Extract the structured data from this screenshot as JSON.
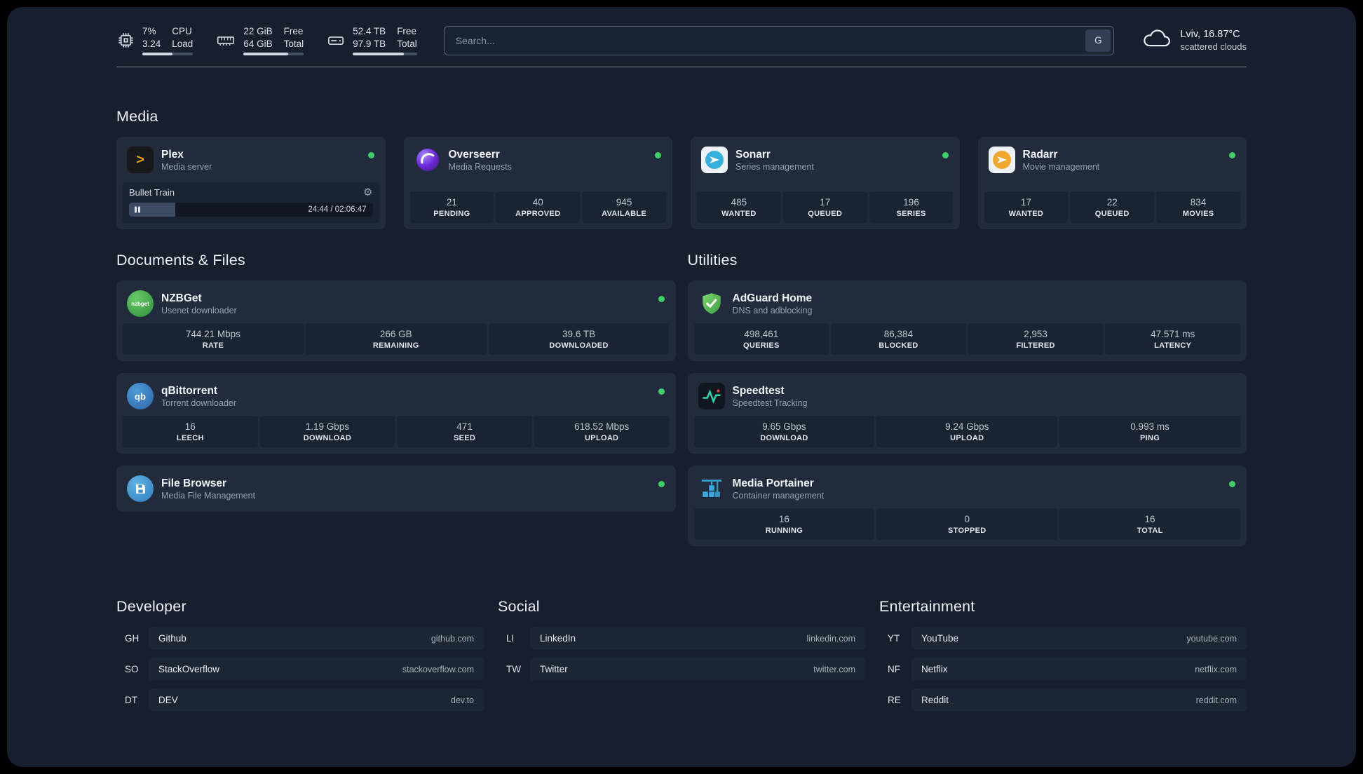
{
  "topbar": {
    "resources": [
      {
        "col1_top": "7%",
        "col1_bottom": "3.24",
        "col2_top": "CPU",
        "col2_bottom": "Load",
        "bar_percent": 60
      },
      {
        "col1_top": "22 GiB",
        "col1_bottom": "64 GiB",
        "col2_top": "Free",
        "col2_bottom": "Total",
        "bar_percent": 74
      },
      {
        "col1_top": "52.4 TB",
        "col1_bottom": "97.9 TB",
        "col2_top": "Free",
        "col2_bottom": "Total",
        "bar_percent": 80
      }
    ],
    "search": {
      "placeholder": "Search...",
      "provider_label": "G"
    },
    "weather": {
      "location": "Lviv, 16.87°C",
      "condition": "scattered clouds"
    }
  },
  "media": {
    "title": "Media",
    "cards": [
      {
        "name": "Plex",
        "description": "Media server",
        "icon_text": ">",
        "now_playing": {
          "title": "Bullet Train",
          "time": "24:44 / 02:06:47",
          "progress_percent": 19
        }
      },
      {
        "name": "Overseerr",
        "description": "Media Requests",
        "stats": [
          {
            "value": "21",
            "label": "PENDING"
          },
          {
            "value": "40",
            "label": "APPROVED"
          },
          {
            "value": "945",
            "label": "AVAILABLE"
          }
        ]
      },
      {
        "name": "Sonarr",
        "description": "Series management",
        "stats": [
          {
            "value": "485",
            "label": "WANTED"
          },
          {
            "value": "17",
            "label": "QUEUED"
          },
          {
            "value": "196",
            "label": "SERIES"
          }
        ]
      },
      {
        "name": "Radarr",
        "description": "Movie management",
        "stats": [
          {
            "value": "17",
            "label": "WANTED"
          },
          {
            "value": "22",
            "label": "QUEUED"
          },
          {
            "value": "834",
            "label": "MOVIES"
          }
        ]
      }
    ]
  },
  "documents": {
    "title": "Documents & Files",
    "cards": [
      {
        "name": "NZBGet",
        "description": "Usenet downloader",
        "icon_text": "nzbget",
        "stats": [
          {
            "value": "744.21 Mbps",
            "label": "RATE"
          },
          {
            "value": "266 GB",
            "label": "REMAINING"
          },
          {
            "value": "39.6 TB",
            "label": "DOWNLOADED"
          }
        ]
      },
      {
        "name": "qBittorrent",
        "description": "Torrent downloader",
        "icon_text": "qb",
        "stats": [
          {
            "value": "16",
            "label": "LEECH"
          },
          {
            "value": "1.19 Gbps",
            "label": "DOWNLOAD"
          },
          {
            "value": "471",
            "label": "SEED"
          },
          {
            "value": "618.52 Mbps",
            "label": "UPLOAD"
          }
        ]
      },
      {
        "name": "File Browser",
        "description": "Media File Management",
        "stats": []
      }
    ]
  },
  "utilities": {
    "title": "Utilities",
    "cards": [
      {
        "name": "AdGuard Home",
        "description": "DNS and adblocking",
        "stats": [
          {
            "value": "498,461",
            "label": "QUERIES"
          },
          {
            "value": "86,384",
            "label": "BLOCKED"
          },
          {
            "value": "2,953",
            "label": "FILTERED"
          },
          {
            "value": "47.571 ms",
            "label": "LATENCY"
          }
        ]
      },
      {
        "name": "Speedtest",
        "description": "Speedtest Tracking",
        "stats": [
          {
            "value": "9.65 Gbps",
            "label": "DOWNLOAD"
          },
          {
            "value": "9.24 Gbps",
            "label": "UPLOAD"
          },
          {
            "value": "0.993 ms",
            "label": "PING"
          }
        ]
      },
      {
        "name": "Media Portainer",
        "description": "Container management",
        "stats": [
          {
            "value": "16",
            "label": "RUNNING"
          },
          {
            "value": "0",
            "label": "STOPPED"
          },
          {
            "value": "16",
            "label": "TOTAL"
          }
        ]
      }
    ]
  },
  "bookmarks": [
    {
      "title": "Developer",
      "items": [
        {
          "abbr": "GH",
          "name": "Github",
          "url": "github.com"
        },
        {
          "abbr": "SO",
          "name": "StackOverflow",
          "url": "stackoverflow.com"
        },
        {
          "abbr": "DT",
          "name": "DEV",
          "url": "dev.to"
        }
      ]
    },
    {
      "title": "Social",
      "items": [
        {
          "abbr": "LI",
          "name": "LinkedIn",
          "url": "linkedin.com"
        },
        {
          "abbr": "TW",
          "name": "Twitter",
          "url": "twitter.com"
        }
      ]
    },
    {
      "title": "Entertainment",
      "items": [
        {
          "abbr": "YT",
          "name": "YouTube",
          "url": "youtube.com"
        },
        {
          "abbr": "NF",
          "name": "Netflix",
          "url": "netflix.com"
        },
        {
          "abbr": "RE",
          "name": "Reddit",
          "url": "reddit.com"
        }
      ]
    }
  ]
}
